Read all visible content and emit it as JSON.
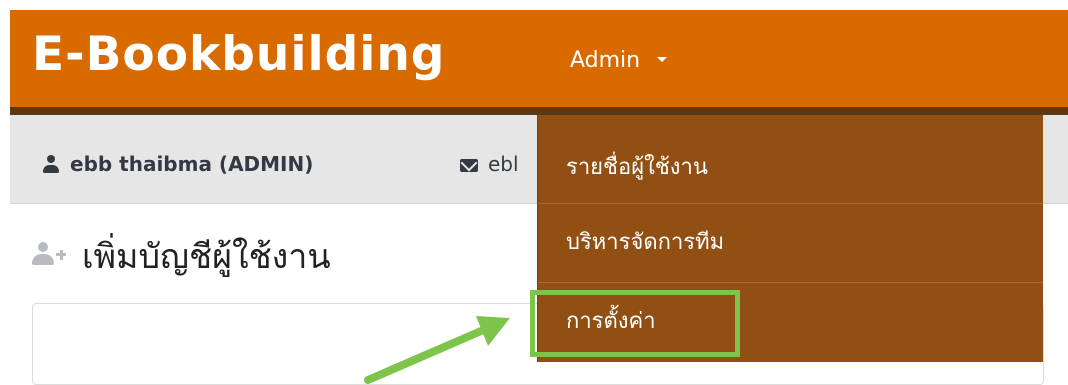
{
  "navbar": {
    "brand": "E-Bookbuilding",
    "admin_label": "Admin",
    "background_color": "#d96a00"
  },
  "userbar": {
    "user_name": "ebb thaibma (ADMIN)",
    "email_visible": "ebl",
    "user_icon": "user-icon",
    "email_icon": "envelope-icon"
  },
  "page": {
    "title": "เพิ่มบัญชีผู้ใช้งาน",
    "title_icon": "user-add-icon"
  },
  "dropdown": {
    "background_color": "#924f13",
    "items": [
      {
        "label": "รายชื่อผู้ใช้งาน"
      },
      {
        "label": "บริหารจัดการทีม"
      },
      {
        "label": "การตั้งค่า",
        "highlighted": true
      }
    ]
  },
  "annotation": {
    "highlight_color": "#7cc44a",
    "arrow_color": "#7cc44a",
    "target": "การตั้งค่า"
  }
}
